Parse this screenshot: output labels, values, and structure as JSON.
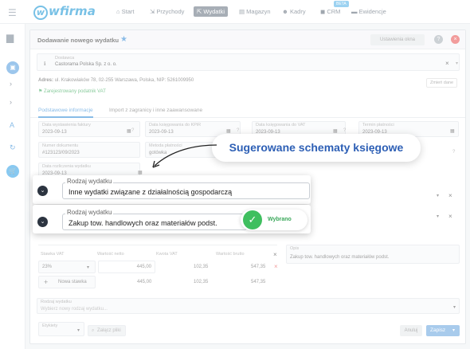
{
  "topbar": {
    "logo": "wfirma",
    "nav": [
      "Start",
      "Przychody",
      "Wydatki",
      "Magazyn",
      "Kadry",
      "CRM",
      "Ewidencje"
    ],
    "beta": "BETA"
  },
  "modal": {
    "title": "Dodawanie nowego wydatku",
    "settings_btn": "Ustawienia okna",
    "supplier_label": "Dostawca",
    "supplier_value": "Castorama Polska Sp. z o. o.",
    "address_label": "Adres:",
    "address_value": "ul. Krakowiaków 78, 02-255 Warszawa, Polska, NIP: 5261009950",
    "vat_payer": "Zarejestrowany podatnik VAT",
    "change_data": "Zmień dane",
    "tabs": [
      "Podstawowe informacje",
      "Import z zagranicy i inne zaawansowane"
    ],
    "fields": {
      "issue_date_label": "Data wystawienia faktury",
      "issue_date": "2023-09-13",
      "kpir_date_label": "Data księgowania do KPiR",
      "kpir_date": "2023-09-13",
      "vat_date_label": "Data księgowania do VAT",
      "vat_date": "2023-09-13",
      "due_label": "Termin płatności",
      "due_date": "2023-09-13",
      "doc_no_label": "Numer dokumentu",
      "doc_no": "#123123/09/2023",
      "payment_label": "Metoda płatności",
      "payment": "gotówka",
      "receipt_label": "Data rozliczenia wydatku",
      "receipt_date": "2023-09-13"
    },
    "vat_table": {
      "headers": [
        "Stawka VAT",
        "Wartość netto",
        "Kwota VAT",
        "Wartość brutto"
      ],
      "row": {
        "rate": "23%",
        "net": "445,00",
        "vat": "102,35",
        "gross": "547,35"
      },
      "add_rate": "Nowa stawka",
      "sum": {
        "net": "445,00",
        "vat": "102,35",
        "gross": "547,35"
      }
    },
    "desc_label": "Opis",
    "desc_value": "Zakup tow. handlowych oraz materiałów podst.",
    "expense_type_label": "Rodzaj wydatku",
    "expense_type_placeholder": "Wybierz nowy rodzaj wydatku...",
    "tags_label": "Etykiety",
    "attach": "Załącz pliki",
    "cancel": "Anuluj",
    "save": "Zapisz"
  },
  "overlay": {
    "callout": "Sugerowane schematy księgowe",
    "card1_label": "Rodzaj wydatku",
    "card1_value": "Inne wydatki związane z działalnością gospodarczą",
    "card2_label": "Rodzaj wydatku",
    "card2_value": "Zakup tow. handlowych oraz materiałów podst.",
    "chosen": "Wybrano"
  }
}
